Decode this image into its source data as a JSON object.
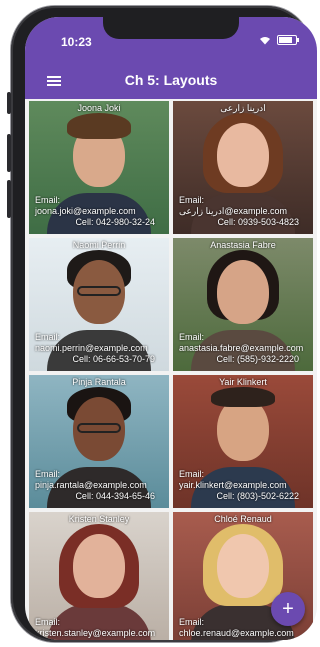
{
  "status": {
    "time": "10:23"
  },
  "appbar": {
    "title": "Ch 5: Layouts",
    "menu_icon": "hamburger-menu-icon"
  },
  "fab": {
    "label": "+",
    "icon": "add-icon"
  },
  "colors": {
    "accent": "#6b4ab0"
  },
  "contacts": [
    {
      "name": "Joona Joki",
      "email_label": "Email:",
      "email": "joona.joki@example.com",
      "cell": "Cell: 042-980-32-24"
    },
    {
      "name": "ادرینا زارعی",
      "email_label": "Email:",
      "email": "ادرینا زارعی@example.com",
      "cell": "Cell: 0939-503-4823"
    },
    {
      "name": "Naomi Perrin",
      "email_label": "Email:",
      "email": "naomi.perrin@example.com",
      "cell": "Cell: 06-66-53-70-79"
    },
    {
      "name": "Anastasia Fabre",
      "email_label": "Email:",
      "email": "anastasia.fabre@example.com",
      "cell": "Cell: (585)-932-2220"
    },
    {
      "name": "Pinja Rantala",
      "email_label": "Email:",
      "email": "pinja.rantala@example.com",
      "cell": "Cell: 044-394-65-46"
    },
    {
      "name": "Yair Klinkert",
      "email_label": "Email:",
      "email": "yair.klinkert@example.com",
      "cell": "Cell: (803)-502-6222"
    },
    {
      "name": "Kristen Stanley",
      "email_label": "Email:",
      "email": "kristen.stanley@example.com",
      "cell": ""
    },
    {
      "name": "Chloé Renaud",
      "email_label": "Email:",
      "email": "chloe.renaud@example.com",
      "cell": ""
    }
  ]
}
